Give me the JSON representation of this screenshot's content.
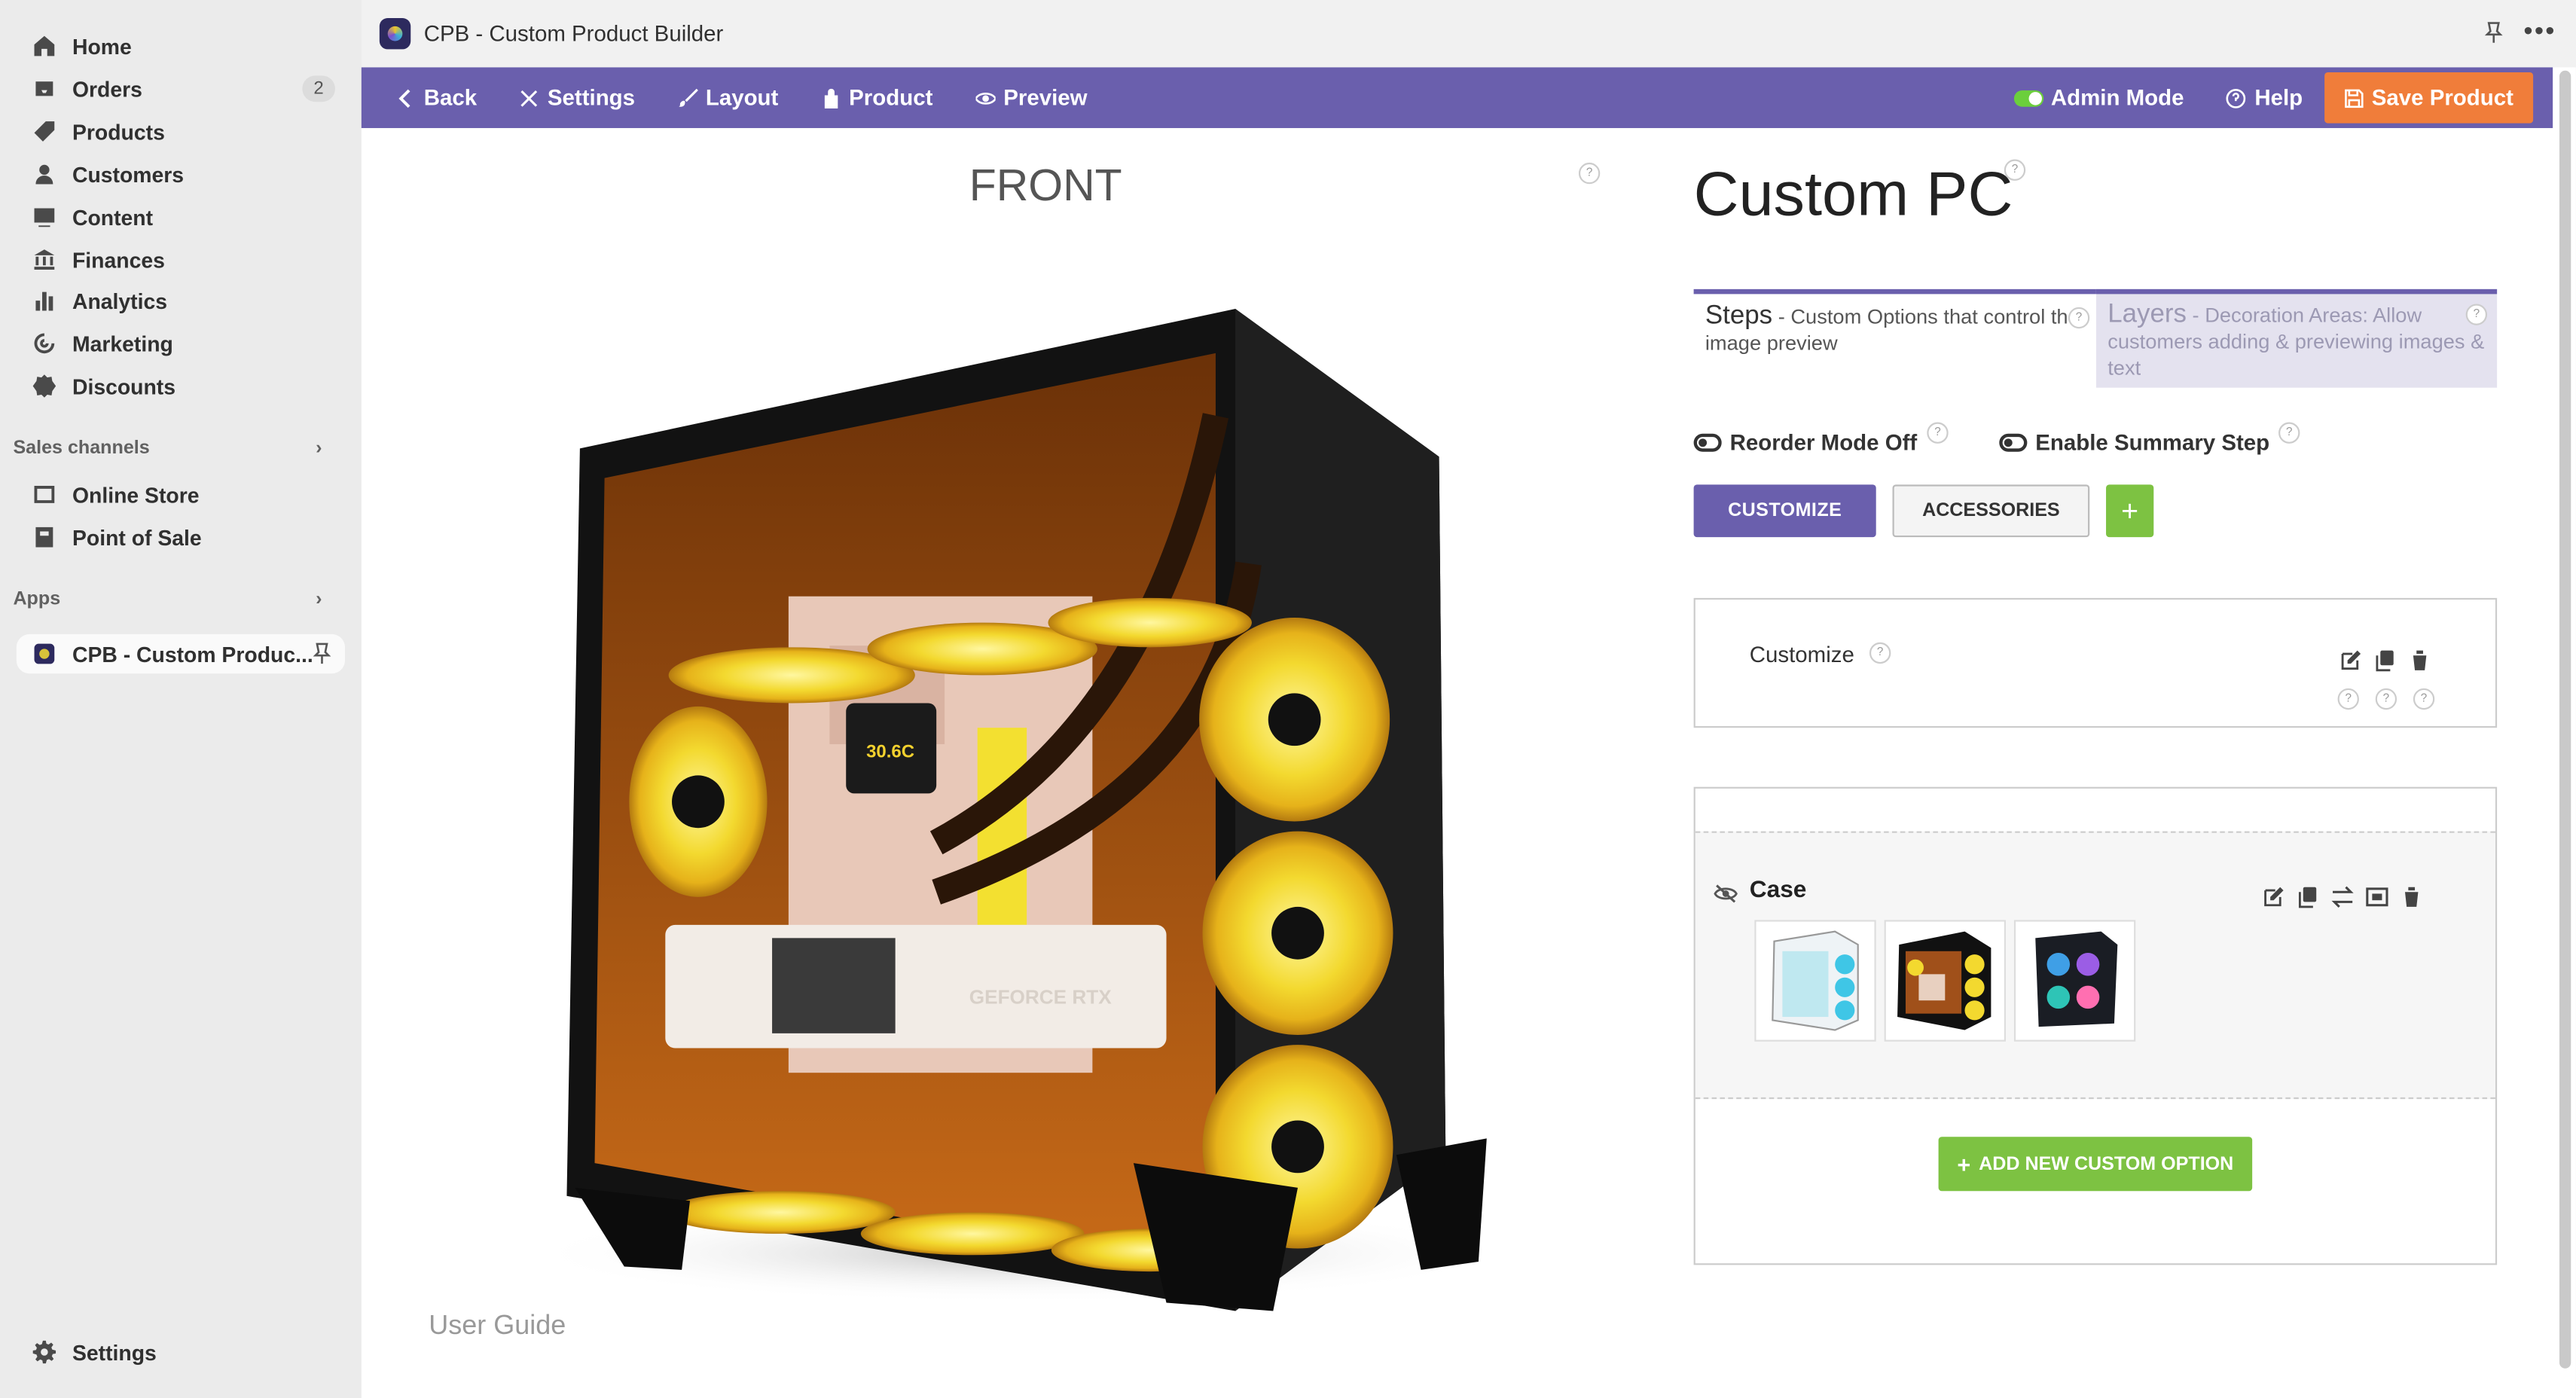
{
  "sidebar": {
    "items": [
      {
        "label": "Home",
        "icon": "home-icon"
      },
      {
        "label": "Orders",
        "icon": "orders-icon",
        "badge": "2"
      },
      {
        "label": "Products",
        "icon": "tag-icon"
      },
      {
        "label": "Customers",
        "icon": "person-icon"
      },
      {
        "label": "Content",
        "icon": "content-icon"
      },
      {
        "label": "Finances",
        "icon": "bank-icon"
      },
      {
        "label": "Analytics",
        "icon": "bar-chart-icon"
      },
      {
        "label": "Marketing",
        "icon": "target-icon"
      },
      {
        "label": "Discounts",
        "icon": "discount-icon"
      }
    ],
    "sales_channels_label": "Sales channels",
    "channels": [
      {
        "label": "Online Store",
        "icon": "store-icon"
      },
      {
        "label": "Point of Sale",
        "icon": "pos-icon"
      }
    ],
    "apps_label": "Apps",
    "app_item": "CPB - Custom Produc...",
    "settings_label": "Settings"
  },
  "titlebar": {
    "title": "CPB - Custom Product Builder"
  },
  "toolbar": {
    "back": "Back",
    "settings": "Settings",
    "layout": "Layout",
    "product": "Product",
    "preview": "Preview",
    "admin_mode": "Admin Mode",
    "help": "Help",
    "save": "Save Product"
  },
  "preview": {
    "view_label": "FRONT",
    "user_guide": "User Guide"
  },
  "editor": {
    "product_title": "Custom PC",
    "steps_tab_title": "Steps",
    "steps_tab_desc": " - Custom Options that control the image preview",
    "layers_tab_title": "Layers",
    "layers_tab_desc": " - Decoration Areas: Allow customers adding & previewing images & text",
    "reorder_mode": "Reorder Mode Off",
    "summary_step": "Enable Summary Step",
    "step_buttons": [
      "CUSTOMIZE",
      "ACCESSORIES"
    ],
    "plus": "+",
    "step_name": "Customize",
    "option_name": "Case",
    "add_option": "ADD NEW CUSTOM OPTION",
    "help_mark": "?"
  },
  "colors": {
    "toolbar": "#6a5fad",
    "save": "#f07d3a",
    "green": "#7dc242"
  }
}
